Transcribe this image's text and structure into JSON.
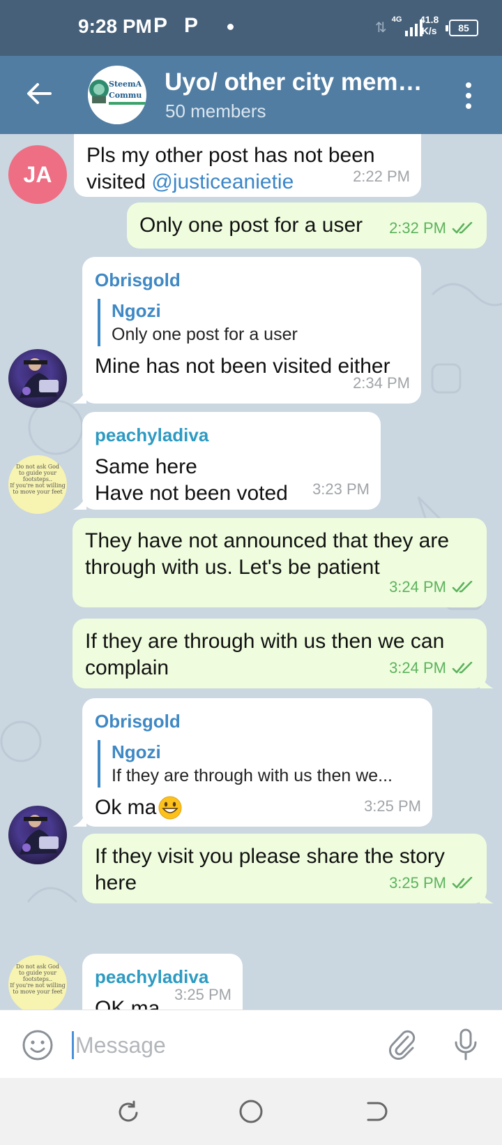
{
  "status_bar": {
    "time": "9:28 PM",
    "notif_icons": [
      "P",
      "P"
    ],
    "network_type": "4G",
    "speed_value": "41.8",
    "speed_unit": "K/s",
    "battery": "85"
  },
  "header": {
    "group_name": "Uyo/ other city memb...",
    "member_count": "50 members",
    "avatar_text": [
      "SteemA",
      "Commu"
    ]
  },
  "messages": [
    {
      "direction": "in",
      "text": "Pls my other post has not been visited ",
      "mention": "@justiceanietie",
      "time": "2:22 PM",
      "avatar_initials": "JA"
    },
    {
      "direction": "out",
      "text": "Only one post for a user",
      "time": "2:32 PM"
    },
    {
      "direction": "in",
      "sender": "Obrisgold",
      "reply_name": "Ngozi",
      "reply_text": "Only one post for a user",
      "text": "Mine has not been visited either",
      "time": "2:34 PM"
    },
    {
      "direction": "in",
      "sender": "peachyladiva",
      "text_lines": [
        "Same here",
        "Have not been voted"
      ],
      "time": "3:23 PM"
    },
    {
      "direction": "out",
      "text_lines": [
        "They have not announced that they are",
        "through with us. Let's be patient"
      ],
      "time": "3:24 PM"
    },
    {
      "direction": "out",
      "text_lines": [
        "If they are through with us then we can",
        "complain"
      ],
      "time": "3:24 PM"
    },
    {
      "direction": "in",
      "sender": "Obrisgold",
      "reply_name": "Ngozi",
      "reply_text": "If they are through with us then we...",
      "text": "Ok ma",
      "time": "3:25 PM"
    },
    {
      "direction": "out",
      "text_lines": [
        "If they visit you please share the story",
        "here"
      ],
      "time": "3:25 PM"
    },
    {
      "direction": "in",
      "sender": "peachyladiva",
      "text": "OK ma",
      "time": "3:25 PM"
    }
  ],
  "input": {
    "placeholder": "Message"
  },
  "colors": {
    "header": "#517da2",
    "status_bar": "#46607a",
    "outgoing_bubble": "#effdde",
    "incoming_bubble": "#ffffff",
    "chat_background": "#cad6e0",
    "read_check": "#5cb25d"
  }
}
